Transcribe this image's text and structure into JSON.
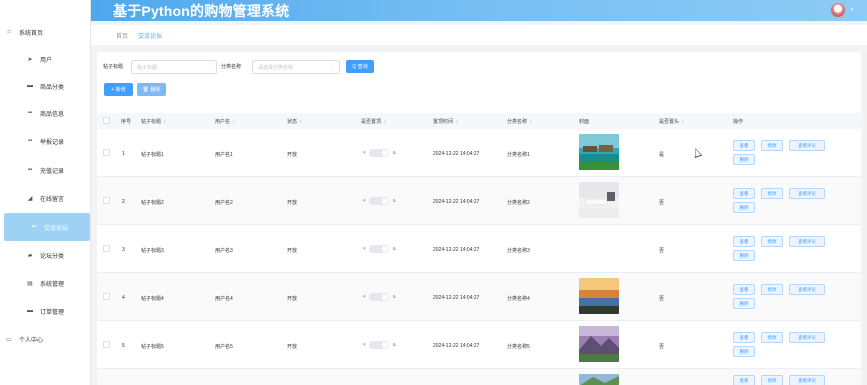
{
  "header": {
    "app_title": "基于Python的购物管理系统",
    "avatar_caret": "▾"
  },
  "tabs": [
    {
      "label": "首页"
    },
    {
      "label": "交流论坛"
    }
  ],
  "sidebar": {
    "items": [
      {
        "label": "系统首页",
        "icon": "⌂"
      },
      {
        "label": "用户",
        "icon": "➤"
      },
      {
        "label": "商品分类",
        "icon": "▬"
      },
      {
        "label": "商品信息",
        "icon": "▪▪"
      },
      {
        "label": "举报记录",
        "icon": "▪▪"
      },
      {
        "label": "充值记录",
        "icon": "▪▪"
      },
      {
        "label": "在线留言",
        "icon": "◢"
      },
      {
        "label": "交流论坛",
        "icon": "▪▪"
      },
      {
        "label": "论坛分类",
        "icon": "▰"
      },
      {
        "label": "系统管理",
        "icon": "▤"
      },
      {
        "label": "订单管理",
        "icon": "▬"
      },
      {
        "label": "个人中心",
        "icon": "▭"
      }
    ]
  },
  "search": {
    "title_label": "帖子标题",
    "title_placeholder": "帖子标题",
    "category_label": "分类名称",
    "category_placeholder": "请选择分类名称",
    "category_caret": "⌄",
    "query_button": "Q 查询",
    "add_button": "+ 新增",
    "delete_button": "🗑 删除"
  },
  "table": {
    "columns": [
      "序号",
      "帖子标题",
      "用户名",
      "状态",
      "是否置顶",
      "置顶时间",
      "分类名称",
      "封面",
      "是否置头",
      "操作"
    ],
    "sort_glyph": "⇕",
    "switch_left": "<",
    "switch_right": "≥",
    "rows": [
      {
        "no": "1",
        "title": "帖子标题1",
        "user": "用户名1",
        "status": "开放",
        "pin_time": "2024-12-22 14:04:27",
        "category": "分类名称1",
        "is_top": "是",
        "cover": "sea"
      },
      {
        "no": "2",
        "title": "帖子标题2",
        "user": "用户名2",
        "status": "开放",
        "pin_time": "2024-12-22 14:04:27",
        "category": "分类名称2",
        "is_top": "否",
        "cover": "desk"
      },
      {
        "no": "3",
        "title": "帖子标题3",
        "user": "用户名3",
        "status": "开放",
        "pin_time": "2024-12-22 14:04:27",
        "category": "分类名称3",
        "is_top": "否",
        "cover": "none"
      },
      {
        "no": "4",
        "title": "帖子标题4",
        "user": "用户名4",
        "status": "开放",
        "pin_time": "2024-12-22 14:04:27",
        "category": "分类名称4",
        "is_top": "否",
        "cover": "sunset"
      },
      {
        "no": "5",
        "title": "帖子标题5",
        "user": "用户名5",
        "status": "开放",
        "pin_time": "2024-12-22 14:04:27",
        "category": "分类名称5",
        "is_top": "否",
        "cover": "mountain"
      }
    ],
    "actions": {
      "view": "查看",
      "edit": "修改",
      "comments": "查看评论",
      "delete": "删除"
    }
  },
  "colors": {
    "primary": "#409eff",
    "header_start": "#4fa8ec",
    "sidebar_active": "#9ed2f4"
  }
}
